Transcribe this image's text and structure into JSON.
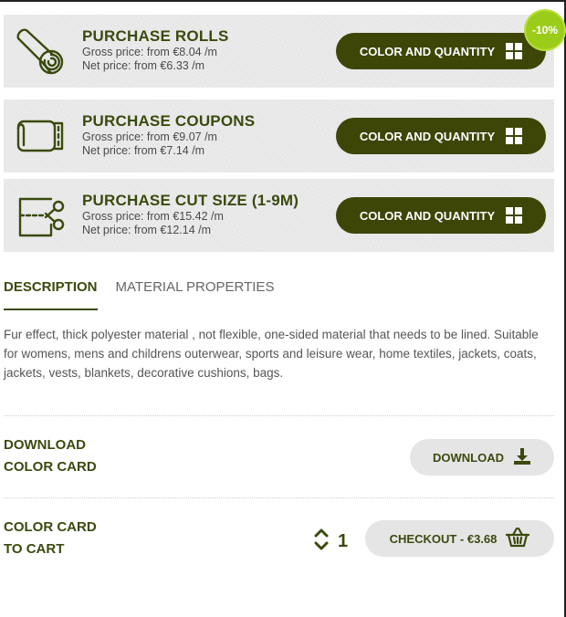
{
  "purchase_options": [
    {
      "title": "PURCHASE ROLLS",
      "gross": "Gross price: from €8.04 /m",
      "net": "Net price: from €6.33 /m",
      "button": "COLOR AND QUANTITY",
      "icon": "fabric-roll-icon"
    },
    {
      "title": "PURCHASE COUPONS",
      "gross": "Gross price: from €9.07 /m",
      "net": "Net price: from €7.14 /m",
      "button": "COLOR AND QUANTITY",
      "icon": "fabric-coupon-icon"
    },
    {
      "title": "PURCHASE CUT SIZE (1-9M)",
      "gross": "Gross price: from €15.42 /m",
      "net": "Net price: from €12.14 /m",
      "button": "COLOR AND QUANTITY",
      "icon": "scissors-cut-icon"
    }
  ],
  "discount_badge": "-10%",
  "tabs": [
    {
      "label": "DESCRIPTION",
      "active": true
    },
    {
      "label": "MATERIAL PROPERTIES",
      "active": false
    }
  ],
  "description": "Fur effect, thick polyester material , not flexible, one-sided material that needs to be lined. Suitable for womens, mens and childrens outerwear, sports and leisure wear, home textiles, jackets, coats, jackets, vests, blankets, decorative cushions, bags.",
  "download_card": {
    "label_line1": "DOWNLOAD",
    "label_line2": "COLOR CARD",
    "button": "DOWNLOAD"
  },
  "cart_card": {
    "label_line1": "COLOR CARD",
    "label_line2": "TO CART",
    "quantity": "1",
    "button": "CHECKOUT - €3.68"
  },
  "colors": {
    "brand_dark": "#3d4607",
    "badge_green": "#9ccc1a",
    "card_bg": "#e6e6e6"
  }
}
